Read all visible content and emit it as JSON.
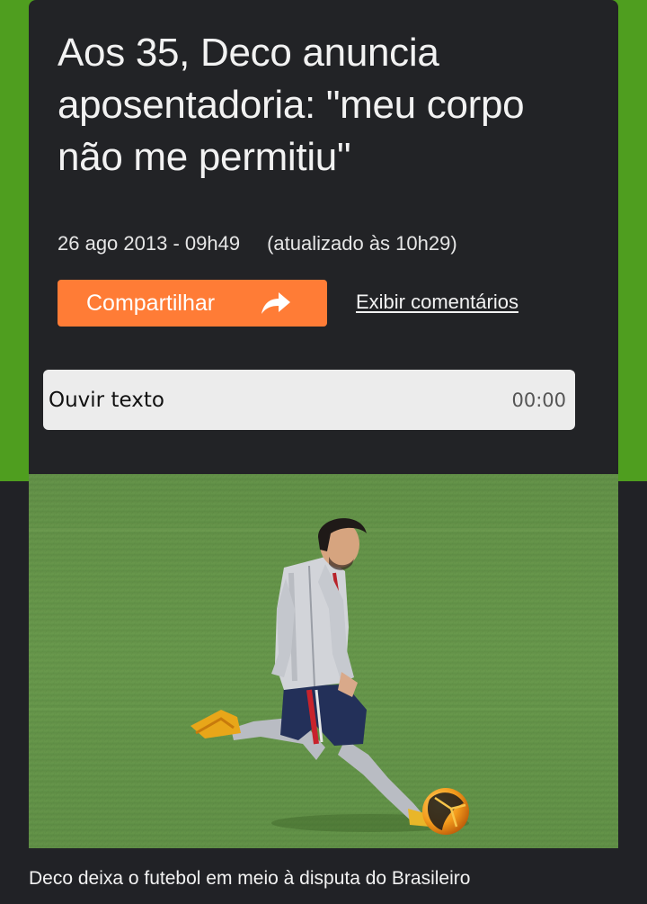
{
  "article": {
    "headline": "Aos 35, Deco anuncia aposentadoria: \"meu corpo não me permitiu\"",
    "date": "26 ago 2013 - 09h49",
    "updated": "(atualizado às 10h29)"
  },
  "actions": {
    "share_label": "Compartilhar",
    "share_icon": "share-arrow-icon",
    "comments_label": "Exibir comentários"
  },
  "audio": {
    "label": "Ouvir texto",
    "time": "00:00"
  },
  "photo": {
    "caption": "Deco deixa o futebol em meio à disputa do Brasileiro"
  },
  "colors": {
    "accent_green": "#4f9e1f",
    "card_bg": "#222326",
    "share_orange": "#ff7c36",
    "audio_bg": "#ececec"
  }
}
